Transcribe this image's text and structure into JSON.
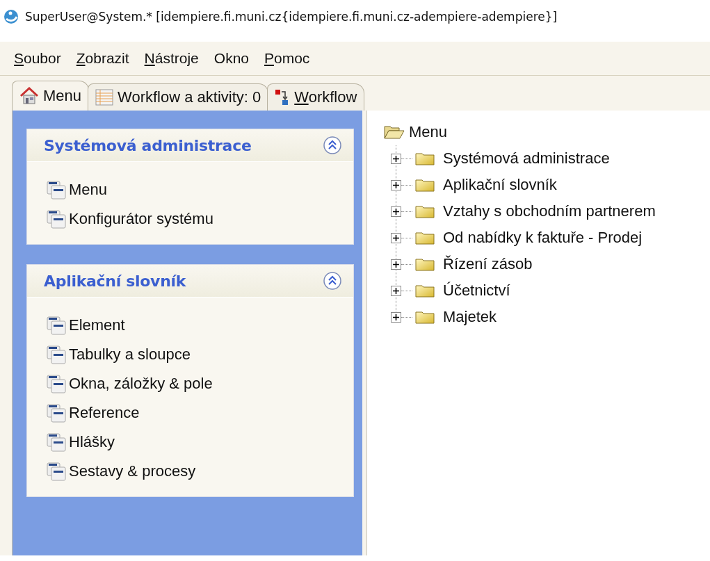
{
  "window": {
    "title": "SuperUser@System.* [idempiere.fi.muni.cz{idempiere.fi.muni.cz-adempiere-adempiere}]"
  },
  "menu_bar": [
    {
      "label": "Soubor",
      "mnemonic": true
    },
    {
      "label": "Zobrazit",
      "mnemonic": true
    },
    {
      "label": "Nástroje",
      "mnemonic": true
    },
    {
      "label": "Okno",
      "mnemonic": false
    },
    {
      "label": "Pomoc",
      "mnemonic": true
    }
  ],
  "tabs": [
    {
      "label": "Menu",
      "kind": "home",
      "selected": true,
      "mnemonic": false
    },
    {
      "label": "Workflow a aktivity: 0",
      "kind": "activities",
      "selected": false,
      "mnemonic": false
    },
    {
      "label": "Workflow",
      "kind": "workflow",
      "selected": false,
      "mnemonic": true
    }
  ],
  "sections": [
    {
      "title": "Systémová administrace",
      "expanded": true,
      "items": [
        "Menu",
        "Konfigurátor systému"
      ]
    },
    {
      "title": "Aplikační slovník",
      "expanded": true,
      "items": [
        "Element",
        "Tabulky a sloupce",
        "Okna, záložky & pole",
        "Reference",
        "Hlášky",
        "Sestavy & procesy"
      ]
    }
  ],
  "tree": {
    "label": "Menu",
    "expanded": true,
    "children": [
      {
        "label": "Systémová administrace",
        "expanded": false
      },
      {
        "label": "Aplikační slovník",
        "expanded": false
      },
      {
        "label": "Vztahy s obchodním partnerem",
        "expanded": false
      },
      {
        "label": "Od nabídky k faktuře - Prodej",
        "expanded": false
      },
      {
        "label": "Řízení zásob",
        "expanded": false
      },
      {
        "label": "Účetnictví",
        "expanded": false
      },
      {
        "label": "Majetek",
        "expanded": false
      }
    ]
  }
}
